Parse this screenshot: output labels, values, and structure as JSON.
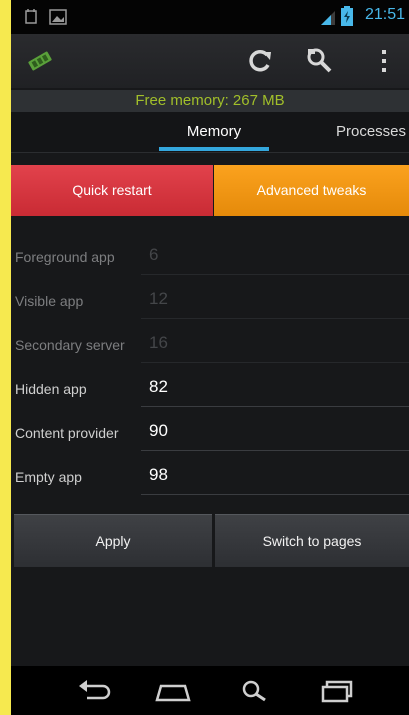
{
  "status_bar": {
    "time": "21:51"
  },
  "free_memory": "Free memory: 267 MB",
  "tabs": [
    {
      "label": "Memory",
      "selected": true
    },
    {
      "label": "Processes",
      "selected": false
    }
  ],
  "quick_actions": {
    "quick_restart": "Quick restart",
    "advanced_tweaks": "Advanced tweaks"
  },
  "rows": [
    {
      "label": "Foreground app",
      "value": "6",
      "enabled": false
    },
    {
      "label": "Visible app",
      "value": "12",
      "enabled": false
    },
    {
      "label": "Secondary server",
      "value": "16",
      "enabled": false
    },
    {
      "label": "Hidden app",
      "value": "82",
      "enabled": true
    },
    {
      "label": "Content provider",
      "value": "90",
      "enabled": true
    },
    {
      "label": "Empty app",
      "value": "98",
      "enabled": true
    }
  ],
  "bottom_buttons": {
    "apply": "Apply",
    "switch_pages": "Switch to pages"
  },
  "colors": {
    "accent": "#34a7dd",
    "free_memory_text": "#a1bf2a",
    "quick_restart": "#d6353e",
    "advanced_tweaks": "#f29516",
    "frame": "#f6e94f"
  },
  "icons": {
    "status_left": [
      "usb-debug-icon",
      "image-notification-icon"
    ],
    "status_right": [
      "signal-icon",
      "battery-icon"
    ],
    "action_bar": [
      "memory-chip-icon",
      "refresh-icon",
      "search-icon",
      "overflow-menu-icon"
    ],
    "nav_bar": [
      "back-icon",
      "home-icon",
      "search-icon",
      "recent-apps-icon"
    ]
  }
}
